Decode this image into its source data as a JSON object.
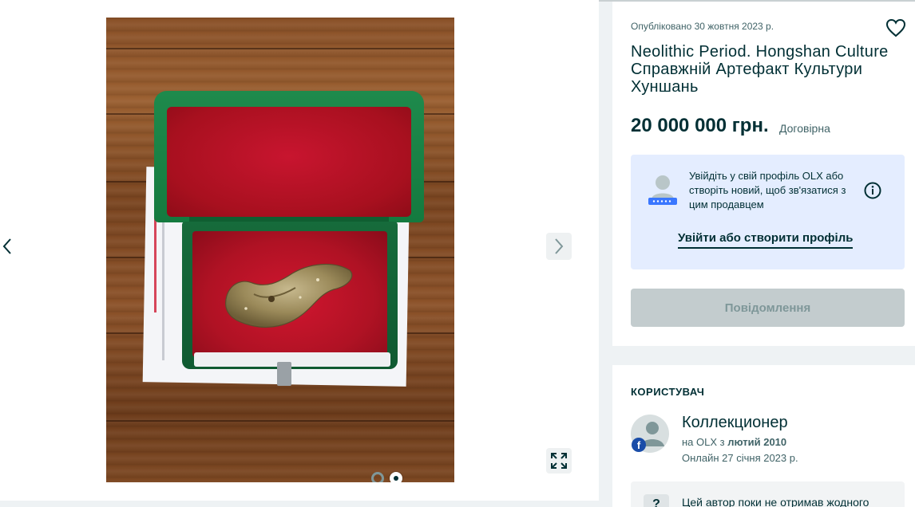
{
  "listing": {
    "published": "Опубліковано 30 жовтня 2023 р.",
    "title": "Neolithic Period. Hongshan Culture Справжній Артефакт Культури Хуншань",
    "price": "20 000 000 грн.",
    "negotiable": "Договірна"
  },
  "login_prompt": {
    "text": "Увійдіть у свій профіль OLX або створіть новий, щоб зв'язатися з цим продавцем",
    "link": "Увійти або створити профіль"
  },
  "message_button": "Повідомлення",
  "user": {
    "heading": "КОРИСТУВАЧ",
    "name": "Коллекционер",
    "since_prefix": "на OLX з ",
    "since_date": "лютий 2010",
    "online": "Онлайн 27 січня 2023 р."
  },
  "rating": {
    "icon_text": "?",
    "text": "Цей автор поки не отримав жодного"
  },
  "gallery": {
    "total_images": 2,
    "active_index": 2
  },
  "colors": {
    "primary_text": "#002f34",
    "secondary_text": "#406367",
    "login_box_bg": "#e4edff",
    "disabled_button_bg": "#c3ccce",
    "page_bg": "#eef2f4"
  },
  "icons": {
    "prev": "chevron-left-icon",
    "next": "chevron-right-icon",
    "fullscreen": "expand-icon",
    "favorite": "heart-icon",
    "info": "info-icon",
    "facebook": "facebook-icon"
  }
}
